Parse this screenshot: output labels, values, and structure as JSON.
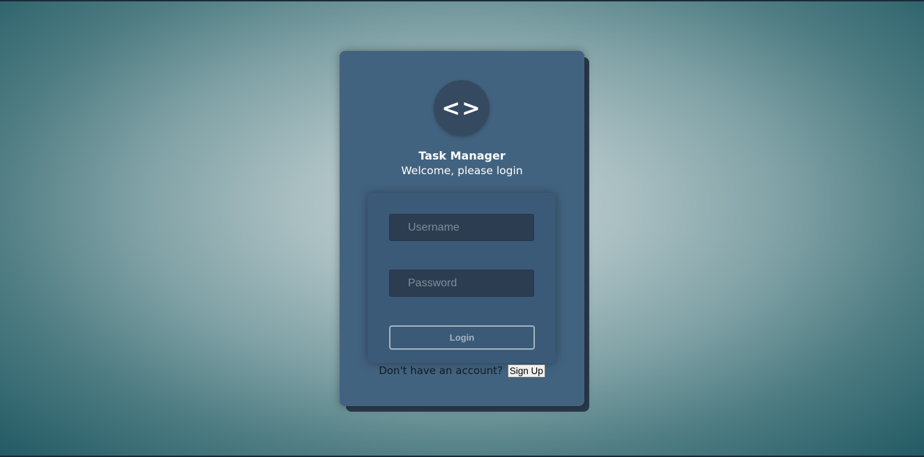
{
  "app": {
    "logo_symbol": "<>",
    "title": "Task Manager",
    "subtitle": "Welcome, please login"
  },
  "form": {
    "username_placeholder": "Username",
    "password_placeholder": "Password",
    "login_label": "Login"
  },
  "signup": {
    "prompt": "Don't have an account?",
    "button_label": "Sign Up"
  },
  "colors": {
    "card": "#426380",
    "panel": "#3b5a77",
    "logo_bg": "#354a60",
    "input_bg": "#2c3d52",
    "button_border": "#a3b4c2"
  }
}
